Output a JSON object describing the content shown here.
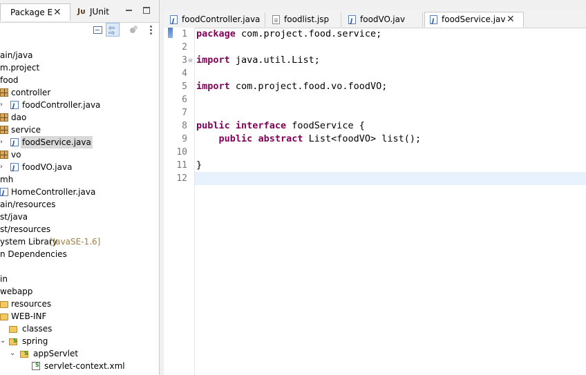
{
  "left_view": {
    "tabs": [
      {
        "label": "Package E",
        "close": "✕"
      },
      {
        "icon_text": "Jᴜ",
        "label": "JUnit"
      }
    ],
    "tree": [
      {
        "text": "ain/java"
      },
      {
        "text": "m.project"
      },
      {
        "text": "food"
      },
      {
        "text": "controller"
      },
      {
        "text": "foodController.java"
      },
      {
        "text": "dao"
      },
      {
        "text": "service"
      },
      {
        "text": "foodService.java"
      },
      {
        "text": "vo"
      },
      {
        "text": "foodVO.java"
      },
      {
        "text": "mh"
      },
      {
        "text": "HomeController.java"
      },
      {
        "text": "ain/resources"
      },
      {
        "text": "st/java"
      },
      {
        "text": "st/resources"
      },
      {
        "text": "ystem Library",
        "decor": "[JavaSE-1.6]"
      },
      {
        "text": "n Dependencies"
      },
      {
        "text": ""
      },
      {
        "text": "in"
      },
      {
        "text": "webapp"
      },
      {
        "text": "resources"
      },
      {
        "text": "WEB-INF"
      },
      {
        "text": "classes"
      },
      {
        "text": "spring"
      },
      {
        "text": "appServlet"
      },
      {
        "text": "servlet-context.xml"
      }
    ]
  },
  "editor": {
    "tabs": [
      {
        "label": "foodController.java"
      },
      {
        "label": "foodlist.jsp"
      },
      {
        "label": "foodVO.jav"
      },
      {
        "label": "foodService.jav",
        "active": true,
        "close": "✕"
      }
    ],
    "line_numbers": [
      "1",
      "2",
      "3",
      "4",
      "5",
      "6",
      "7",
      "8",
      "9",
      "10",
      "11",
      "12"
    ],
    "code": {
      "l1_kw": "package",
      "l1_rest": " com.project.food.service;",
      "l3_kw": "import",
      "l3_rest": " java.util.List;",
      "l5_kw": "import",
      "l5_rest": " com.project.food.vo.foodVO;",
      "l8_kw1": "public",
      "l8_kw2": "interface",
      "l8_rest": " foodService {",
      "l9_kw1": "public",
      "l9_kw2": "abstract",
      "l9_rest": " List<foodVO> list();",
      "l11": "}"
    },
    "current_line": 12
  },
  "colors": {
    "keyword": "#7f0055",
    "current_line_highlight": "#e8f2fe",
    "selection": "#d9d9d9"
  }
}
